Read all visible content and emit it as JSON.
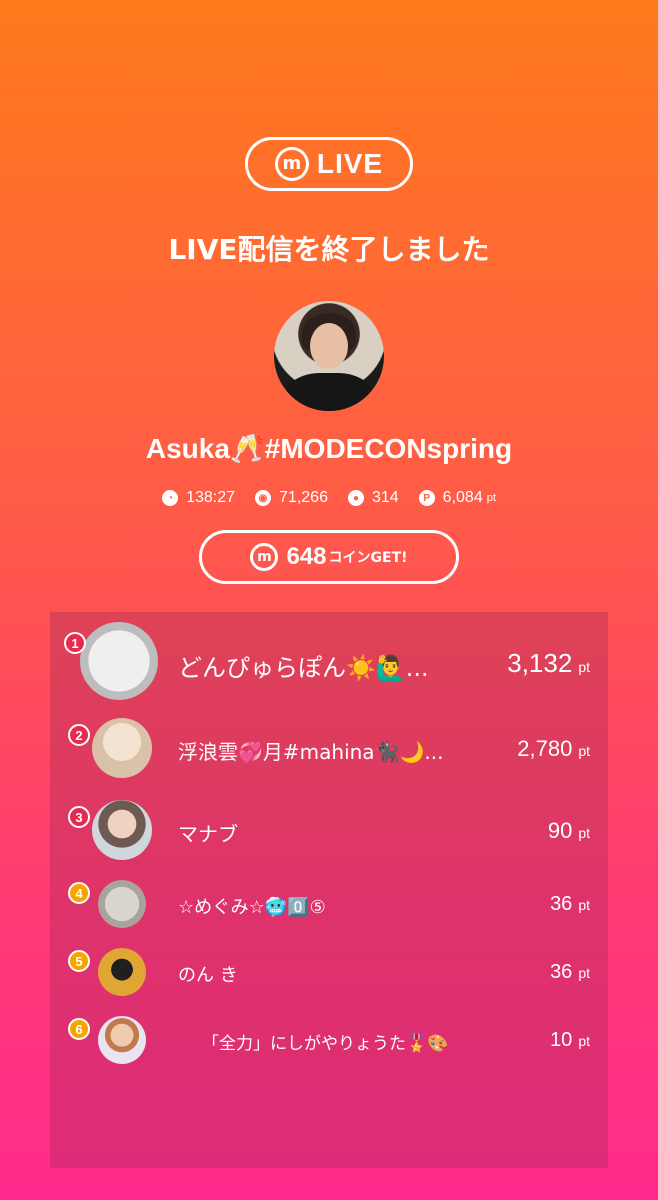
{
  "header": {
    "logo_mark": "m",
    "logo_text": "LIVE",
    "title": "LIVE配信を終了しました"
  },
  "streamer": {
    "name": "Asuka🥂#MODECONspring"
  },
  "stats": {
    "duration": "138:27",
    "viewers": "71,266",
    "comments": "314",
    "points": "6,084",
    "points_unit": "pt"
  },
  "coin": {
    "mark": "m",
    "amount": "648",
    "suffix": "コインGET!"
  },
  "ranking": [
    {
      "rank": "1",
      "name": "どんぴゅらぽん☀️🙋‍♂️...",
      "points": "3,132",
      "unit": "pt"
    },
    {
      "rank": "2",
      "name": "浮浪雲💞月#mahina🐈‍⬛🌙...",
      "points": "2,780",
      "unit": "pt"
    },
    {
      "rank": "3",
      "name": "マナブ",
      "points": "90",
      "unit": "pt"
    },
    {
      "rank": "4",
      "name": "☆めぐみ☆🥶0️⃣⑤",
      "points": "36",
      "unit": "pt"
    },
    {
      "rank": "5",
      "name": "のん き",
      "points": "36",
      "unit": "pt"
    },
    {
      "rank": "6",
      "name": "「全力」にしがやりょうた🎖️🎨",
      "points": "10",
      "unit": "pt"
    }
  ],
  "colors": {
    "gradient_top": "#ff7a1c",
    "gradient_bottom": "#ff2b8c",
    "badge_top3": "#e62b4f",
    "badge_other": "#f7a400"
  },
  "icons": [
    "m-logo-icon",
    "duration-icon",
    "viewers-icon",
    "comments-icon",
    "points-icon",
    "coin-icon"
  ]
}
